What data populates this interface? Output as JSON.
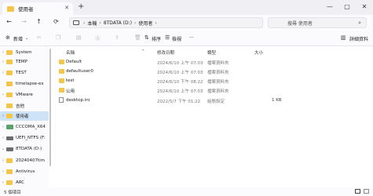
{
  "window": {
    "tab_title": "使用者",
    "tab_close": "✕",
    "new_tab": "+",
    "controls": [
      "—",
      "▢",
      "✕"
    ]
  },
  "address": {
    "nav": [
      "←",
      "→",
      "↑",
      "⟳"
    ],
    "crumbs": [
      "本機",
      "8TDATA (D:)",
      "使用者"
    ],
    "separator": "›",
    "more": "›",
    "search_placeholder": "搜尋 使用者"
  },
  "toolbar": {
    "new_label": "新增",
    "sort_label": "排序",
    "view_label": "檢視",
    "more_label": "···",
    "details_label": "詳細資料"
  },
  "sidebar": {
    "items": [
      {
        "label": "System",
        "kind": "folder",
        "chevron": "›"
      },
      {
        "label": "TEMP",
        "kind": "folder",
        "chevron": "›"
      },
      {
        "label": "TEST",
        "kind": "folder",
        "chevron": "›"
      },
      {
        "label": "timelapse-ex",
        "kind": "folder",
        "chevron": ""
      },
      {
        "label": "VMware",
        "kind": "folder",
        "chevron": "›"
      },
      {
        "label": "吉他",
        "kind": "folder",
        "chevron": ""
      },
      {
        "label": "使用者",
        "kind": "folder",
        "chevron": "›",
        "selected": true
      },
      {
        "label": "CCCOMA_X64",
        "kind": "net",
        "chevron": "›"
      },
      {
        "label": "UEFI_NTFS (F:",
        "kind": "drive",
        "chevron": "›"
      },
      {
        "label": "8TDATA (D:)",
        "kind": "drive",
        "chevron": "⌄"
      },
      {
        "label": "20240407tim",
        "kind": "folder",
        "chevron": "›"
      },
      {
        "label": "Antivirus",
        "kind": "folder",
        "chevron": "›"
      },
      {
        "label": "ARC",
        "kind": "folder",
        "chevron": "›"
      }
    ]
  },
  "files": {
    "columns": [
      "名稱",
      "修改日期",
      "類型",
      "大小"
    ],
    "sort_indicator": "^",
    "rows": [
      {
        "name": "Default",
        "date": "2024/6/10 上午 07:03",
        "type": "檔案資料夾",
        "size": "",
        "kind": "folder"
      },
      {
        "name": "defaultuser0",
        "date": "2024/6/10 上午 07:03",
        "type": "檔案資料夾",
        "size": "",
        "kind": "folder"
      },
      {
        "name": "test",
        "date": "2024/6/10 下午 08:22",
        "type": "檔案資料夾",
        "size": "",
        "kind": "folder"
      },
      {
        "name": "公用",
        "date": "2024/6/10 上午 07:03",
        "type": "檔案資料夾",
        "size": "",
        "kind": "folder"
      },
      {
        "name": "desktop.ini",
        "date": "2022/5/7 下午 01:22",
        "type": "組態設定",
        "size": "1 KB",
        "kind": "doc"
      }
    ]
  },
  "status": {
    "item_count": "5 個項目"
  }
}
